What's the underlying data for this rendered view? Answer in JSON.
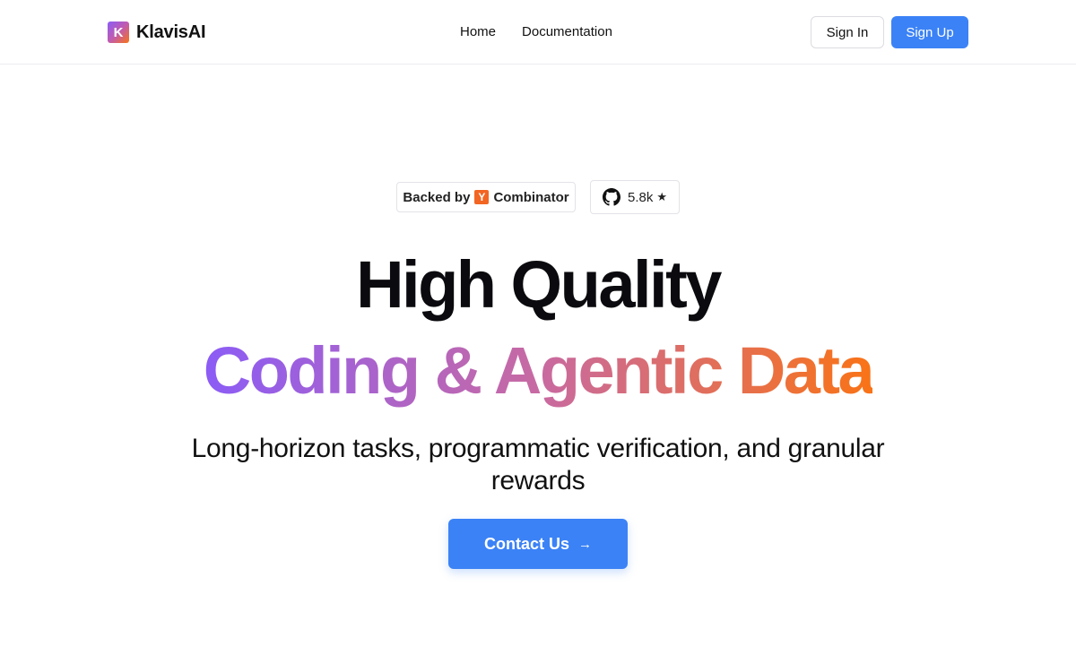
{
  "header": {
    "logo_letter": "K",
    "brand": "KlavisAI",
    "nav": [
      {
        "label": "Home"
      },
      {
        "label": "Documentation"
      }
    ],
    "sign_in": "Sign In",
    "sign_up": "Sign Up"
  },
  "badges": {
    "yc_prefix": "Backed by",
    "yc_letter": "Y",
    "yc_suffix": "Combinator",
    "github_stars": "5.8k",
    "star_glyph": "★",
    "github_icon": "github-icon"
  },
  "hero": {
    "headline_line1": "High Quality",
    "headline_line2": "Coding & Agentic Data",
    "subtitle": "Long-horizon tasks, programmatic verification, and granular rewards",
    "cta_label": "Contact Us",
    "cta_arrow": "→"
  },
  "colors": {
    "accent": "#3b82f6",
    "gradient_start": "#8b5cf6",
    "gradient_end": "#f97316",
    "yc_orange": "#f26522"
  }
}
